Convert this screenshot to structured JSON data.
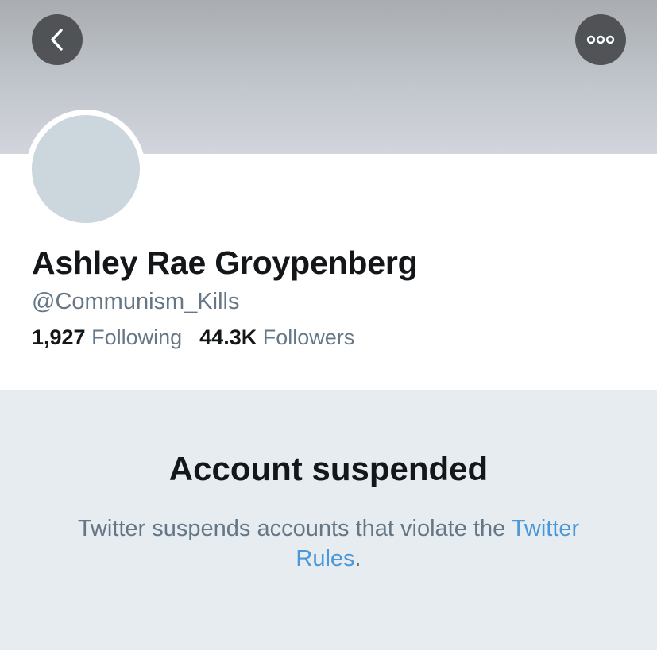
{
  "header": {
    "back_icon": "chevron-left-icon",
    "more_icon": "ellipsis-icon"
  },
  "profile": {
    "display_name": "Ashley Rae Groypenberg",
    "handle": "@Communism_Kills",
    "following_count": "1,927",
    "following_label": "Following",
    "followers_count": "44.3K",
    "followers_label": "Followers"
  },
  "suspension": {
    "title": "Account suspended",
    "message_line1": "Twitter suspends accounts that violate the",
    "rules_link": "Twitter Rules",
    "period": "."
  },
  "colors": {
    "link": "#4a97d9",
    "secondary_text": "#657786",
    "primary_text": "#14171a",
    "panel_bg": "#e6ecf0"
  }
}
